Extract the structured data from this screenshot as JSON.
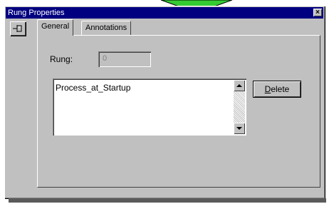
{
  "window": {
    "title": "Rung Properties",
    "close_glyph": "×"
  },
  "tabs": [
    {
      "label": "General",
      "active": true
    },
    {
      "label": "Annotations",
      "active": false
    }
  ],
  "general": {
    "rung_label": "Rung:",
    "rung_value": "0",
    "annotations": [
      "Process_at_Startup"
    ],
    "delete_label_first": "D",
    "delete_label_rest": "elete"
  },
  "colors": {
    "titlebar": "#000080",
    "face": "#c0c0c0",
    "arrow": "#33cc33"
  },
  "icons": {
    "pin": "pin-icon",
    "arrow": "green-arrow-pointer"
  }
}
